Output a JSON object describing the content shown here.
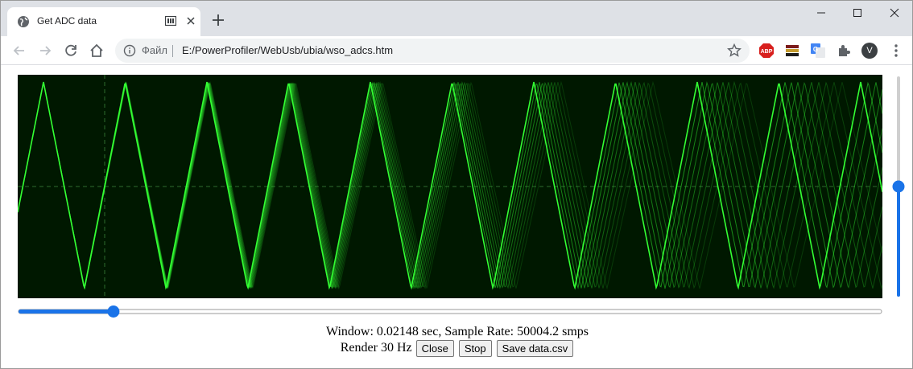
{
  "browser": {
    "tab_title": "Get ADC data",
    "omnibox": {
      "scheme_label": "Файл",
      "url": "E:/PowerProfiler/WebUsb/ubia/wso_adcs.htm"
    },
    "avatar_letter": "V",
    "extensions": [
      "abp-icon",
      "flag-extension-icon",
      "translate-icon",
      "puzzle-icon"
    ],
    "accent_color": "#1a73e8"
  },
  "scope": {
    "background_color": "#001800",
    "trace_color": "#33ff33",
    "grid_color": "#2e6b2e"
  },
  "sliders": {
    "horizontal_fraction": 0.11,
    "vertical_fraction": 0.5
  },
  "status": {
    "window_text": "Window: 0.02148 sec, Sample Rate: 50004.2 smps",
    "render_text": "Render 30 Hz"
  },
  "buttons": {
    "close_label": "Close",
    "stop_label": "Stop",
    "save_label": "Save data.csv"
  }
}
